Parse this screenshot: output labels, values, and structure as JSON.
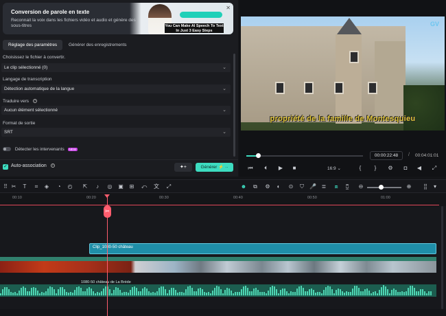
{
  "banner": {
    "title": "Conversion de parole en texte",
    "description": "Reconnait la voix dans les fichiers vidéo et audio et génère des sous-titres",
    "caption": "You Can Make AI Speech To Text In Just 3 Easy Steps"
  },
  "tabs": [
    {
      "label": "Réglage des paramètres",
      "active": true
    },
    {
      "label": "Générer des enregistrements",
      "active": false
    }
  ],
  "form": {
    "file_label": "Choisissez le fichier à convertir.",
    "file_value": "Le clip sélectionné (0)",
    "lang_label": "Langage de transcription",
    "lang_value": "Détection automatique de la langue",
    "translate_label": "Traduire vers",
    "translate_value": "Aucun élément sélectionné",
    "format_label": "Format de sortie",
    "format_value": "SRT",
    "speakers_label": "Détecter les intervenants",
    "speakers_badge": "NEW",
    "auto_label": "Auto-association",
    "ai_button": "✦+",
    "generate_button": "Générer ⚡ ··"
  },
  "preview": {
    "watermark": "GV",
    "subtitle": "propriété de la famille de Montesquieu",
    "current_time": "00:00:22:48",
    "separator": "/",
    "total_time": "00:04:01:01",
    "ratio": "16:9",
    "progress_fraction": 0.1
  },
  "timeline": {
    "ticks": [
      "00:10",
      "00:20",
      "00:30",
      "00:40",
      "00:50",
      "01:00"
    ],
    "text_clip": "Clip_1080-50 château",
    "audio_clip": "1080-50 château de La Brède"
  },
  "colors": {
    "accent": "#3ddcc0",
    "playhead": "#ff5d6e",
    "subtitle": "#e1c53a"
  }
}
